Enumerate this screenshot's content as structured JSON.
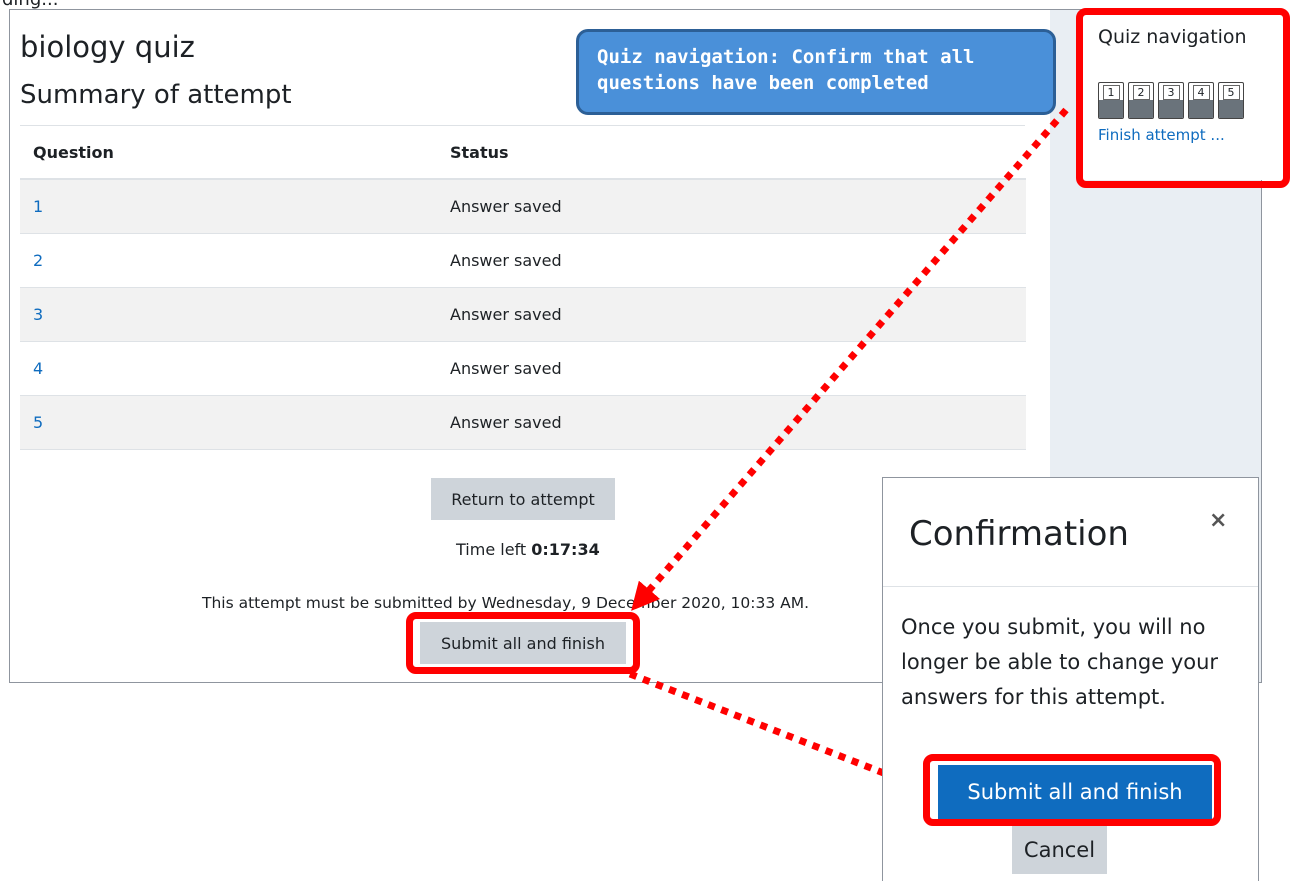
{
  "top_clipped_text": "ding...",
  "quiz": {
    "title": "biology quiz",
    "subtitle": "Summary of attempt"
  },
  "table": {
    "headers": [
      "Question",
      "Status"
    ],
    "rows": [
      {
        "question": "1",
        "status": "Answer saved"
      },
      {
        "question": "2",
        "status": "Answer saved"
      },
      {
        "question": "3",
        "status": "Answer saved"
      },
      {
        "question": "4",
        "status": "Answer saved"
      },
      {
        "question": "5",
        "status": "Answer saved"
      }
    ]
  },
  "actions": {
    "return_label": "Return to attempt",
    "time_left_label": "Time left",
    "time_left_value": "0:17:34",
    "deadline_text": "This attempt must be submitted by Wednesday, 9 December 2020, 10:33 AM.",
    "submit_label": "Submit all and finish"
  },
  "quiz_navigation": {
    "title": "Quiz navigation",
    "buttons": [
      "1",
      "2",
      "3",
      "4",
      "5"
    ],
    "finish_link": "Finish attempt ..."
  },
  "callout": {
    "text": "Quiz navigation: Confirm that all questions have been completed"
  },
  "modal": {
    "title": "Confirmation",
    "close_symbol": "×",
    "body": "Once you submit, you will no longer be able to change your answers for this attempt.",
    "submit_label": "Submit all and finish",
    "cancel_label": "Cancel"
  },
  "colors": {
    "highlight": "#ff0000",
    "link": "#0f6cbf",
    "primary_button": "#0f6cbf",
    "secondary_button": "#ced4da",
    "callout_fill": "#4a90d9",
    "sidebar_bg": "#e9eef3"
  }
}
